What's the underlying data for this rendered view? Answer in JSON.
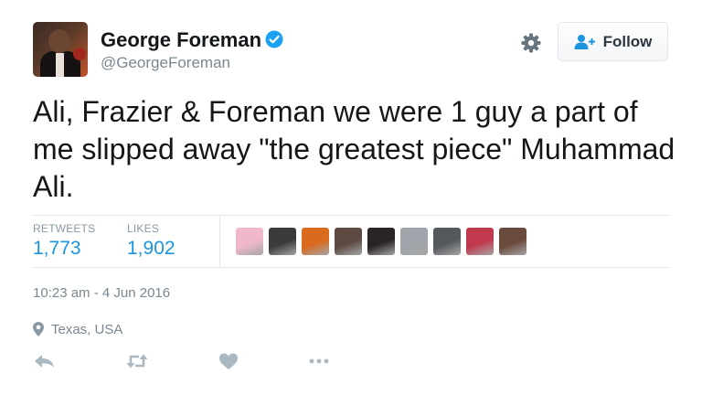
{
  "author": {
    "name": "George Foreman",
    "handle": "@GeorgeForeman",
    "verified": true
  },
  "follow_button": {
    "label": "Follow",
    "icon": "add-person-icon"
  },
  "settings": {
    "icon": "gear-icon"
  },
  "tweet": {
    "text": "Ali, Frazier & Foreman  we were 1 guy a part of me slipped away \"the greatest piece\" Muhammad Ali."
  },
  "stats": {
    "retweets_label": "RETWEETS",
    "retweets_count": "1,773",
    "likes_label": "LIKES",
    "likes_count": "1,902"
  },
  "likers": [
    {
      "icon": "user-avatar",
      "color": "#f0b8c8"
    },
    {
      "icon": "user-avatar",
      "color": "#3b3a3c"
    },
    {
      "icon": "user-avatar",
      "color": "#d96a1e"
    },
    {
      "icon": "user-avatar",
      "color": "#5c4a42"
    },
    {
      "icon": "user-avatar",
      "color": "#2a2328"
    },
    {
      "icon": "user-avatar",
      "color": "#a0a5ab"
    },
    {
      "icon": "user-avatar",
      "color": "#55595e"
    },
    {
      "icon": "user-avatar",
      "color": "#c0394d"
    },
    {
      "icon": "user-avatar",
      "color": "#6b4a3e"
    }
  ],
  "timestamp": "10:23 am - 4 Jun 2016",
  "location": "Texas, USA",
  "actions": [
    {
      "name": "reply",
      "icon": "reply-icon"
    },
    {
      "name": "retweet",
      "icon": "retweet-icon"
    },
    {
      "name": "like",
      "icon": "heart-icon"
    },
    {
      "name": "more",
      "icon": "more-icon"
    }
  ],
  "colors": {
    "accent": "#1b95e0",
    "verified": "#1da1f2",
    "muted": "#8899a6",
    "icon": "#aab8c2"
  }
}
